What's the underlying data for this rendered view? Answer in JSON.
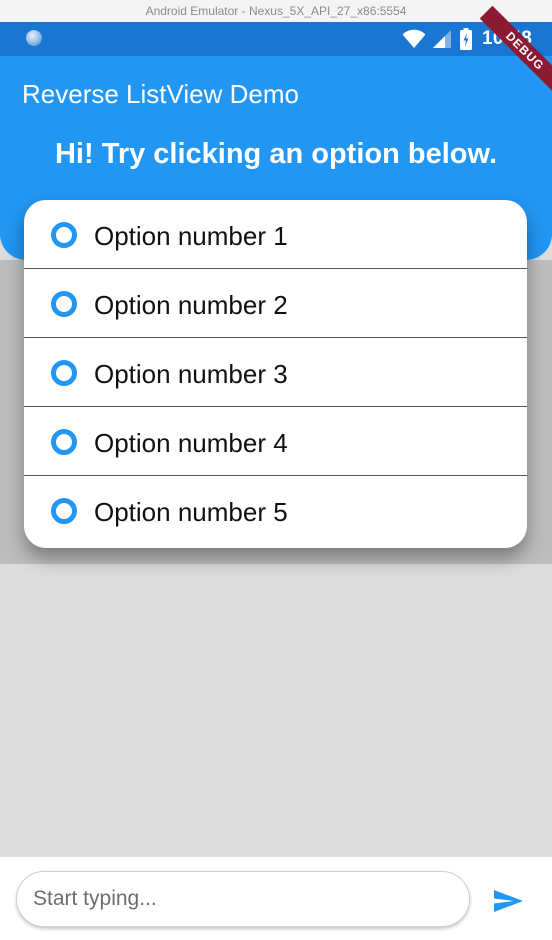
{
  "window": {
    "title": "Android Emulator - Nexus_5X_API_27_x86:5554"
  },
  "status_bar": {
    "time": "10:48",
    "icons": [
      "notification-dot-icon",
      "wifi-icon",
      "cell-signal-icon",
      "battery-icon"
    ],
    "color": "#1976d2"
  },
  "debug_banner": {
    "label": "DEBUG",
    "color": "#8b1a32"
  },
  "app_bar": {
    "title": "Reverse ListView Demo",
    "headline": "Hi! Try clicking an option below.",
    "color": "#2196f3"
  },
  "options": [
    {
      "label": "Option number 1",
      "icon": "radio-unchecked-icon"
    },
    {
      "label": "Option number 2",
      "icon": "radio-unchecked-icon"
    },
    {
      "label": "Option number 3",
      "icon": "radio-unchecked-icon"
    },
    {
      "label": "Option number 4",
      "icon": "radio-unchecked-icon"
    },
    {
      "label": "Option number 5",
      "icon": "radio-unchecked-icon"
    }
  ],
  "composer": {
    "placeholder": "Start typing...",
    "value": "",
    "send_icon": "send-icon"
  },
  "colors": {
    "accent": "#2196f3",
    "background": "#dcdcdc"
  }
}
